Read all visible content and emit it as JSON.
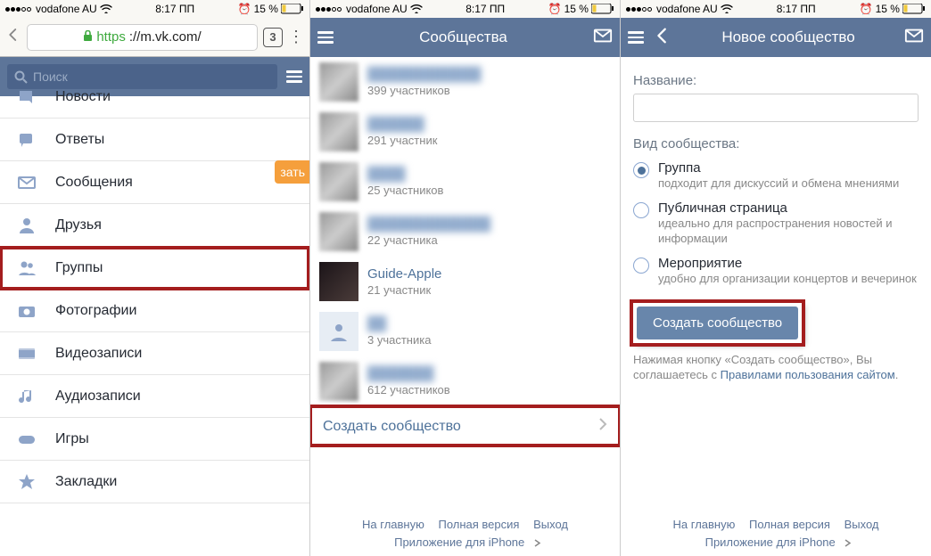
{
  "status": {
    "carrier": "vodafone AU",
    "time": "8:17 ПП",
    "battery": "15 %",
    "alarm_icon": "⏰"
  },
  "left": {
    "url_https": "https",
    "url_domain": "://m.vk.com/",
    "tab_count": "3",
    "search_placeholder": "Поиск",
    "menu": {
      "news": "Новости",
      "replies": "Ответы",
      "messages": "Сообщения",
      "friends": "Друзья",
      "groups": "Группы",
      "photos": "Фотографии",
      "videos": "Видеозаписи",
      "audio": "Аудиозаписи",
      "games": "Игры",
      "bookmarks": "Закладки"
    },
    "orange_badge": "зать"
  },
  "mid": {
    "title": "Сообщества",
    "items": [
      {
        "sub": "399 участников"
      },
      {
        "sub": "291 участник"
      },
      {
        "sub": "25 участников"
      },
      {
        "sub": "22 участника"
      },
      {
        "name": "Guide-Apple",
        "sub": "21 участник",
        "kind": "guide"
      },
      {
        "sub": "3 участника",
        "kind": "blank"
      },
      {
        "sub": "612 участников"
      }
    ],
    "create": "Создать сообщество"
  },
  "right": {
    "title": "Новое сообщество",
    "name_label": "Название:",
    "type_label": "Вид сообщества:",
    "options": {
      "group": {
        "title": "Группа",
        "desc": "подходит для дискуссий и обмена мнениями"
      },
      "public": {
        "title": "Публичная страница",
        "desc": "идеально для распространения новостей и информации"
      },
      "event": {
        "title": "Мероприятие",
        "desc": "удобно для организации концертов и вечеринок"
      }
    },
    "create_button": "Создать сообщество",
    "terms_pre": "Нажимая кнопку «Создать сообщество», Вы соглашаетесь с ",
    "terms_link": "Правилами пользования сайтом",
    "terms_post": "."
  },
  "footer": {
    "home": "На главную",
    "full": "Полная версия",
    "exit": "Выход",
    "app": "Приложение для iPhone"
  }
}
